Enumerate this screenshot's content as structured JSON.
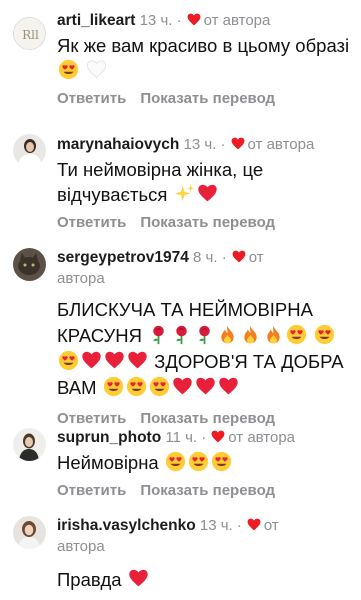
{
  "author_label": "от автора",
  "reply_label": "Ответить",
  "translate_label": "Показать перевод",
  "comments": [
    {
      "username": "arti_likeart",
      "time": "13 ч.",
      "text": "Як же вам красиво в цьому образі",
      "emojis": [
        "heart-eyes",
        "white-heart"
      ]
    },
    {
      "username": "marynahaiovych",
      "time": "13 ч.",
      "text": "Ти неймовірна жінка, це відчувається",
      "emojis": [
        "sparkles",
        "red-heart"
      ]
    },
    {
      "username": "sergeypetrov1974",
      "time": "8 ч.",
      "text_1": "БЛИСКУЧА ТА НЕЙМОВІРНА КРАСУНЯ",
      "text_2": "ЗДОРОВ'Я ТА ДОБРА ВАМ",
      "emojis": [
        "rose",
        "fire",
        "heart-eyes",
        "red-heart"
      ]
    },
    {
      "username": "suprun_photo",
      "time": "11 ч.",
      "text": "Неймовірна",
      "emojis": [
        "heart-eyes"
      ]
    },
    {
      "username": "irisha.vasylchenko",
      "time": "13 ч.",
      "text": "Правда",
      "emojis": [
        "red-heart"
      ]
    }
  ],
  "colors": {
    "heart": "#ed1c24",
    "meta_gray": "#8e8e93"
  }
}
